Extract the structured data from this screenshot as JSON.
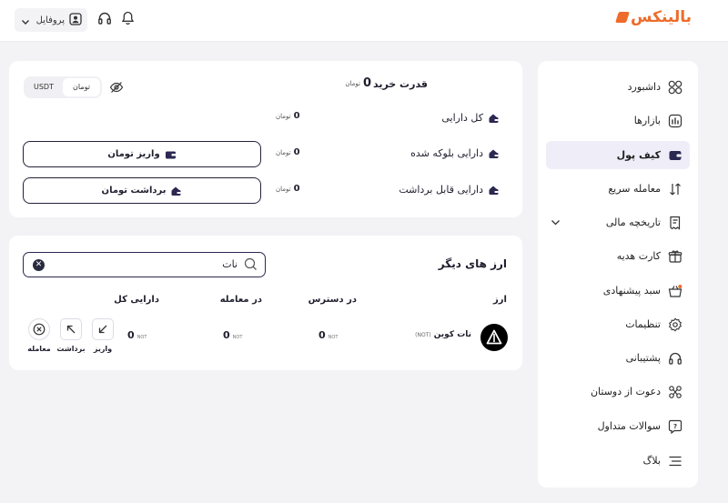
{
  "header": {
    "logo_text": "بالینکس",
    "profile_label": "پروفایل"
  },
  "sidebar": {
    "items": [
      {
        "label": "داشبورد",
        "icon": "grid-icon"
      },
      {
        "label": "بازارها",
        "icon": "chart-icon"
      },
      {
        "label": "کیف پول",
        "icon": "wallet-icon",
        "active": true
      },
      {
        "label": "معامله سریع",
        "icon": "swap-icon"
      },
      {
        "label": "تاریخچه مالی",
        "icon": "receipt-icon",
        "expandable": true
      },
      {
        "label": "کارت هدیه",
        "icon": "gift-icon"
      },
      {
        "label": "سبد پیشنهادی",
        "icon": "basket-icon"
      },
      {
        "label": "تنظیمات",
        "icon": "settings-icon"
      },
      {
        "label": "پشتیبانی",
        "icon": "headset-icon"
      },
      {
        "label": "دعوت از دوستان",
        "icon": "invite-icon"
      },
      {
        "label": "سوالات متداول",
        "icon": "faq-icon"
      },
      {
        "label": "بلاگ",
        "icon": "blog-icon"
      }
    ]
  },
  "assets": {
    "toggle": {
      "usdt": "USDT",
      "toman": "تومان",
      "selected": "toman"
    },
    "buy_power": {
      "label": "قدرت خرید",
      "value": "0",
      "unit": "تومان"
    },
    "total": {
      "label": "کل دارایی",
      "value": "0",
      "unit": "تومان"
    },
    "blocked": {
      "label": "دارایی بلوکه شده",
      "value": "0",
      "unit": "تومان"
    },
    "withdrawable": {
      "label": "دارایی قابل برداشت",
      "value": "0",
      "unit": "تومان"
    },
    "deposit_button": "واریز تومان",
    "withdraw_button": "برداشت تومان"
  },
  "other_currencies": {
    "title": "ارز های دیگر",
    "search_value": "نات",
    "columns": {
      "currency": "ارز",
      "available": "در دسترس",
      "in_trade": "در معامله",
      "total": "دارایی کل"
    },
    "rows": [
      {
        "name": "نات کوین",
        "symbol": "(NOT)",
        "available": "0",
        "in_trade": "0",
        "total": "0",
        "unit": "NOT"
      }
    ],
    "actions": {
      "deposit": "واریز",
      "withdraw": "برداشت",
      "trade": "معامله"
    }
  },
  "colors": {
    "brand": "#ee6c2b",
    "accent": "#2b2852",
    "active_bg": "#efeef8"
  }
}
